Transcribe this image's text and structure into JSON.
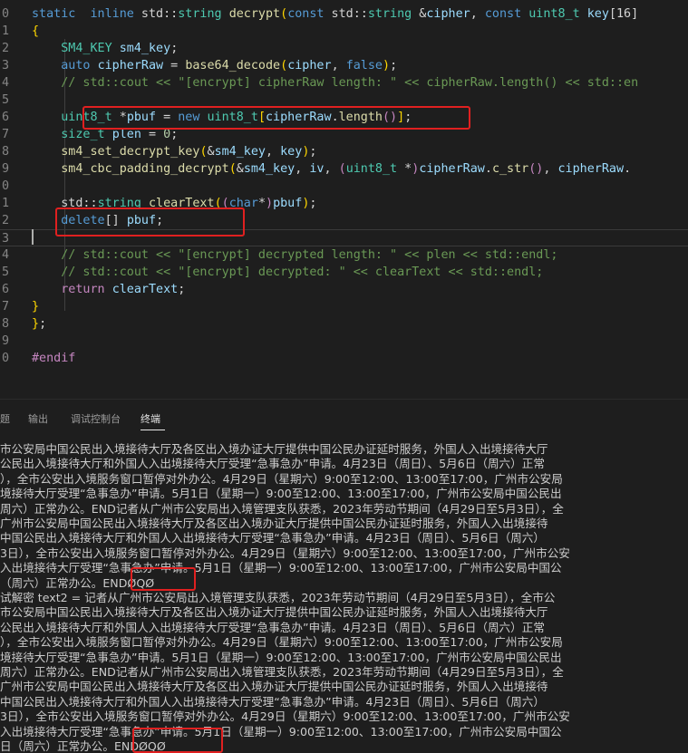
{
  "editor": {
    "lines": [
      {
        "num": "0",
        "tokens": [
          [
            "kw",
            "static"
          ],
          [
            "",
            "  "
          ],
          [
            "kw",
            "inline"
          ],
          [
            "",
            " std::"
          ],
          [
            "ty",
            "string"
          ],
          [
            "",
            " "
          ],
          [
            "fn",
            "decrypt"
          ],
          [
            "br",
            "("
          ],
          [
            "kw",
            "const"
          ],
          [
            "",
            " std::"
          ],
          [
            "ty",
            "string"
          ],
          [
            "",
            " &"
          ],
          [
            "va",
            "cipher"
          ],
          [
            "",
            ", "
          ],
          [
            "kw",
            "const"
          ],
          [
            "",
            " "
          ],
          [
            "ty",
            "uint8_t"
          ],
          [
            "",
            " "
          ],
          [
            "va",
            "key"
          ],
          [
            "",
            "[16]"
          ]
        ]
      },
      {
        "num": "1",
        "tokens": [
          [
            "br",
            "{"
          ]
        ]
      },
      {
        "num": "2",
        "tokens": [
          [
            "",
            "    "
          ],
          [
            "ty",
            "SM4_KEY"
          ],
          [
            "",
            " "
          ],
          [
            "va",
            "sm4_key"
          ],
          [
            "",
            ";"
          ]
        ]
      },
      {
        "num": "3",
        "tokens": [
          [
            "",
            "    "
          ],
          [
            "kw",
            "auto"
          ],
          [
            "",
            " "
          ],
          [
            "va",
            "cipherRaw"
          ],
          [
            "",
            " = "
          ],
          [
            "fn",
            "base64_decode"
          ],
          [
            "br",
            "("
          ],
          [
            "va",
            "cipher"
          ],
          [
            "",
            ", "
          ],
          [
            "kw",
            "false"
          ],
          [
            "br",
            ")"
          ],
          [
            "",
            ";"
          ]
        ]
      },
      {
        "num": "4",
        "tokens": [
          [
            "",
            "    "
          ],
          [
            "cm",
            "// std::cout << \"[encrypt] cipherRaw length: \" << cipherRaw.length() << std::en"
          ]
        ]
      },
      {
        "num": "5",
        "tokens": []
      },
      {
        "num": "6",
        "tokens": [
          [
            "",
            "    "
          ],
          [
            "ty",
            "uint8_t"
          ],
          [
            "",
            " *"
          ],
          [
            "va",
            "pbuf"
          ],
          [
            "",
            " = "
          ],
          [
            "kw",
            "new"
          ],
          [
            "",
            " "
          ],
          [
            "ty",
            "uint8_t"
          ],
          [
            "br",
            "["
          ],
          [
            "va",
            "cipherRaw"
          ],
          [
            "",
            "."
          ],
          [
            "fn",
            "length"
          ],
          [
            "pp",
            "()"
          ],
          [
            "br",
            "]"
          ],
          [
            "",
            ";"
          ]
        ]
      },
      {
        "num": "7",
        "tokens": [
          [
            "",
            "    "
          ],
          [
            "ty",
            "size_t"
          ],
          [
            "",
            " "
          ],
          [
            "va",
            "plen"
          ],
          [
            "",
            " = "
          ],
          [
            "nu",
            "0"
          ],
          [
            "",
            ";"
          ]
        ]
      },
      {
        "num": "8",
        "tokens": [
          [
            "",
            "    "
          ],
          [
            "fn",
            "sm4_set_decrypt_key"
          ],
          [
            "br",
            "("
          ],
          [
            "",
            "&"
          ],
          [
            "va",
            "sm4_key"
          ],
          [
            "",
            ", "
          ],
          [
            "va",
            "key"
          ],
          [
            "br",
            ")"
          ],
          [
            "",
            ";"
          ]
        ]
      },
      {
        "num": "9",
        "tokens": [
          [
            "",
            "    "
          ],
          [
            "fn",
            "sm4_cbc_padding_decrypt"
          ],
          [
            "br",
            "("
          ],
          [
            "",
            "&"
          ],
          [
            "va",
            "sm4_key"
          ],
          [
            "",
            ", "
          ],
          [
            "va",
            "iv"
          ],
          [
            "",
            ", "
          ],
          [
            "pp",
            "("
          ],
          [
            "ty",
            "uint8_t"
          ],
          [
            "",
            " *"
          ],
          [
            "pp",
            ")"
          ],
          [
            "va",
            "cipherRaw"
          ],
          [
            "",
            "."
          ],
          [
            "fn",
            "c_str"
          ],
          [
            "pp",
            "()"
          ],
          [
            "",
            ", "
          ],
          [
            "va",
            "cipherRaw"
          ],
          [
            "",
            "."
          ]
        ]
      },
      {
        "num": "0",
        "tokens": []
      },
      {
        "num": "1",
        "tokens": [
          [
            "",
            "    std::"
          ],
          [
            "ty",
            "string"
          ],
          [
            "",
            " "
          ],
          [
            "fn",
            "clearText"
          ],
          [
            "br",
            "("
          ],
          [
            "pp",
            "("
          ],
          [
            "kw",
            "char"
          ],
          [
            "",
            "*"
          ],
          [
            "pp",
            ")"
          ],
          [
            "va",
            "pbuf"
          ],
          [
            "br",
            ")"
          ],
          [
            "",
            ";"
          ]
        ]
      },
      {
        "num": "2",
        "tokens": [
          [
            "",
            "    "
          ],
          [
            "kw",
            "delete"
          ],
          [
            "",
            "[] "
          ],
          [
            "va",
            "pbuf"
          ],
          [
            "",
            ";"
          ]
        ]
      },
      {
        "num": "3",
        "tokens": []
      },
      {
        "num": "4",
        "tokens": [
          [
            "",
            "    "
          ],
          [
            "cm",
            "// std::cout << \"[encrypt] decrypted length: \" << plen << std::endl;"
          ]
        ]
      },
      {
        "num": "5",
        "tokens": [
          [
            "",
            "    "
          ],
          [
            "cm",
            "// std::cout << \"[encrypt] decrypted: \" << clearText << std::endl;"
          ]
        ]
      },
      {
        "num": "6",
        "tokens": [
          [
            "",
            "    "
          ],
          [
            "pp",
            "return"
          ],
          [
            "",
            " "
          ],
          [
            "va",
            "clearText"
          ],
          [
            "",
            ";"
          ]
        ]
      },
      {
        "num": "7",
        "tokens": [
          [
            "br",
            "}"
          ]
        ]
      },
      {
        "num": "8",
        "tokens": [
          [
            "br",
            "}"
          ],
          [
            "",
            ";"
          ]
        ]
      },
      {
        "num": "9",
        "tokens": []
      },
      {
        "num": "0",
        "tokens": [
          [
            "pp",
            "#endif"
          ]
        ]
      }
    ]
  },
  "panel": {
    "tabs": [
      "题",
      "输出",
      "调试控制台",
      "终端"
    ],
    "active_tab": "终端"
  },
  "terminal": {
    "lines": [
      "市公安局中国公民出入境接待大厅及各区出入境办证大厅提供中国公民办证延时服务，外国人入出境接待大厅",
      "公民出入境接待大厅和外国人入出境接待大厅受理“急事急办”申请。4月23日（周日）、5月6日（周六）正常",
      "），全市公安出入境服务窗口暂停对外办公。4月29日（星期六）9:00至12:00、13:00至17:00，广州市公安局",
      "境接待大厅受理“急事急办”申请。5月1日（星期一）9:00至12:00、13:00至17:00，广州市公安局中国公民出",
      "周六）正常办公。END记者从广州市公安局出入境管理支队获悉，2023年劳动节期间（4月29日至5月3日），全",
      "广州市公安局中国公民出入境接待大厅及各区出入境办证大厅提供中国公民办证延时服务，外国人入出境接待",
      "中国公民出入境接待大厅和外国人入出境接待大厅受理“急事急办”申请。4月23日（周日）、5月6日（周六）",
      "3日），全市公安出入境服务窗口暂停对外办公。4月29日（星期六）9:00至12:00、13:00至17:00，广州市公安",
      "入出境接待大厅受理“急事急办”申请。5月1日（星期一）9:00至12:00、13:00至17:00，广州市公安局中国公",
      "（周六）正常办公。ENDØQØ",
      "试解密 text2 = 记者从广州市公安局出入境管理支队获悉，2023年劳动节期间（4月29日至5月3日），全市公",
      "市公安局中国公民出入境接待大厅及各区出入境办证大厅提供中国公民办证延时服务，外国人入出境接待大厅",
      "公民出入境接待大厅和外国人入出境接待大厅受理“急事急办”申请。4月23日（周日）、5月6日（周六）正常",
      "），全市公安出入境服务窗口暂停对外办公。4月29日（星期六）9:00至12:00、13:00至17:00，广州市公安局",
      "境接待大厅受理“急事急办”申请。5月1日（星期一）9:00至12:00、13:00至17:00，广州市公安局中国公民出",
      "周六）正常办公。END记者从广州市公安局出入境管理支队获悉，2023年劳动节期间（4月29日至5月3日），全",
      "广州市公安局中国公民出入境接待大厅及各区出入境办证大厅提供中国公民办证延时服务，外国人入出境接待",
      "中国公民出入境接待大厅和外国人入出境接待大厅受理“急事急办”申请。4月23日（周日）、5月6日（周六）",
      "3日），全市公安出入境服务窗口暂停对外办公。4月29日（星期六）9:00至12:00、13:00至17:00，广州市公安",
      "入出境接待大厅受理“急事急办”申请。5月1日（星期一）9:00至12:00、13:00至17:00，广州市公安局中国公",
      "日（周六）正常办公。ENDØQØ"
    ]
  },
  "colors": {
    "highlight": "#e02020",
    "background": "#1e1e1e"
  }
}
